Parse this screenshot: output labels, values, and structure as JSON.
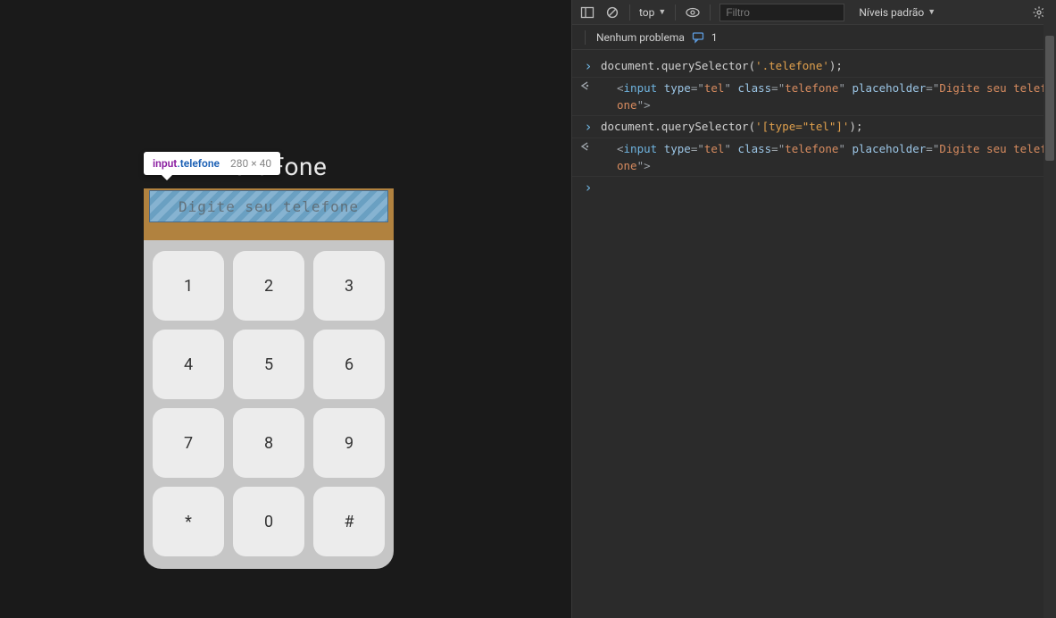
{
  "app": {
    "title": "AluraFone"
  },
  "keys": [
    "1",
    "2",
    "3",
    "4",
    "5",
    "6",
    "7",
    "8",
    "9",
    "*",
    "0",
    "#"
  ],
  "tooltip": {
    "tag": "input",
    "cls": ".telefone",
    "dims": "280 × 40"
  },
  "highlighted_placeholder": "Digite seu telefone",
  "devtools": {
    "context": "top",
    "filter_placeholder": "Filtro",
    "levels_label": "Níveis padrão",
    "issues_text": "Nenhum problema",
    "issues_count": "1",
    "entries": [
      {
        "kind": "input",
        "parts": {
          "pre": "document.querySelector(",
          "arg": "'.telefone'",
          "post": ");"
        }
      },
      {
        "kind": "result",
        "html": {
          "tag": "input",
          "attrs": [
            {
              "n": "type",
              "v": "tel"
            },
            {
              "n": "class",
              "v": "telefone"
            },
            {
              "n": "placeholder",
              "v": "Digite seu telefone"
            }
          ]
        }
      },
      {
        "kind": "input",
        "parts": {
          "pre": "document.querySelector(",
          "arg": "'[type=\"tel\"]'",
          "post": ");"
        }
      },
      {
        "kind": "result",
        "html": {
          "tag": "input",
          "attrs": [
            {
              "n": "type",
              "v": "tel"
            },
            {
              "n": "class",
              "v": "telefone"
            },
            {
              "n": "placeholder",
              "v": "Digite seu telefone"
            }
          ]
        }
      }
    ]
  }
}
